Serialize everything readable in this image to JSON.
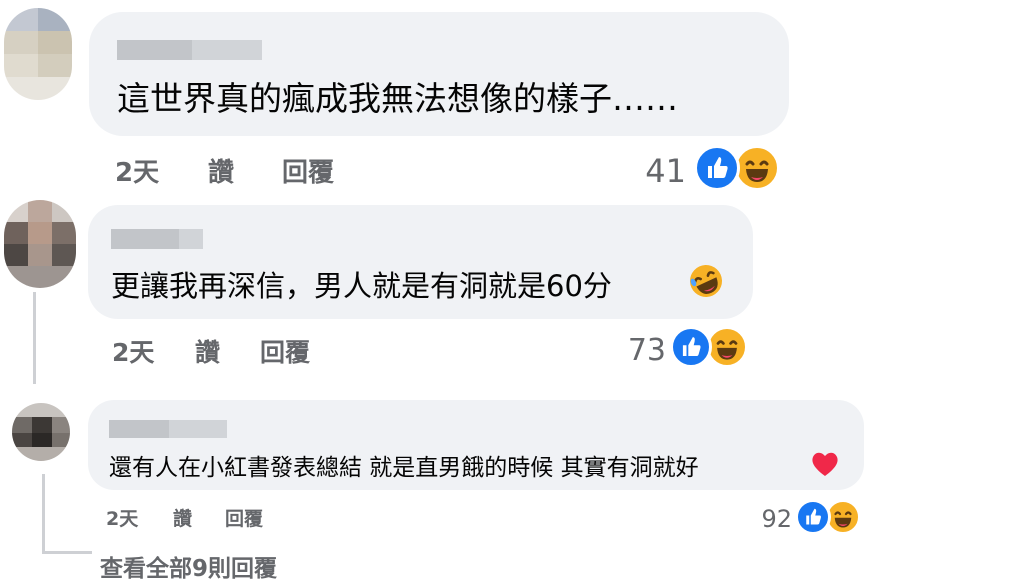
{
  "comments": [
    {
      "text": "這世界真的瘋成我無法想像的樣子……",
      "time": "2天",
      "like_label": "讚",
      "reply_label": "回覆",
      "reaction_count": "41",
      "reactions": [
        "like-icon",
        "haha-icon"
      ]
    },
    {
      "text": "更讓我再深信，男人就是有洞就是60分",
      "inline_emoji": "rofl-emoji",
      "time": "2天",
      "like_label": "讚",
      "reply_label": "回覆",
      "reaction_count": "73",
      "reactions": [
        "like-icon",
        "haha-icon"
      ]
    },
    {
      "text": "還有人在小紅書發表總結 就是直男餓的時候 其實有洞就好",
      "inline_emoji": "red-heart-emoji",
      "time": "2天",
      "like_label": "讚",
      "reply_label": "回覆",
      "reaction_count": "92",
      "reactions": [
        "like-icon",
        "haha-icon"
      ]
    }
  ],
  "view_more_replies": "查看全部9則回覆",
  "colors": {
    "bubble": "#f0f2f5",
    "secondary_text": "#65676b",
    "like_blue": "#1877f2",
    "haha_yellow": "#f7b125",
    "heart_red": "#f02849"
  }
}
